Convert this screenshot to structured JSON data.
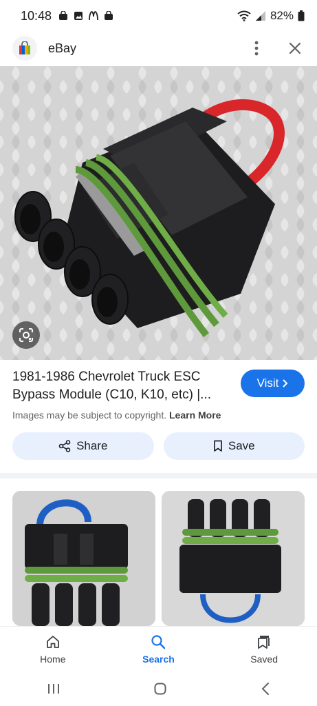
{
  "status_bar": {
    "time": "10:48",
    "battery": "82%"
  },
  "header": {
    "site_name": "eBay"
  },
  "result": {
    "title": "1981-1986 Chevrolet Truck ESC Bypass Module (C10, K10, etc) |...",
    "visit_label": "Visit",
    "copyright_text": "Images may be subject to copyright.",
    "learn_more": "Learn More",
    "share_label": "Share",
    "save_label": "Save"
  },
  "bottom_nav": {
    "items": [
      {
        "label": "Home",
        "icon": "home-icon"
      },
      {
        "label": "Search",
        "icon": "search-icon"
      },
      {
        "label": "Saved",
        "icon": "saved-icon"
      }
    ]
  },
  "colors": {
    "accent": "#1a73e8",
    "pill_bg": "#e8f0fe",
    "wire_red": "#d8262a",
    "wire_blue": "#1f5fc4",
    "seal_green": "#5e9a3b",
    "connector_black": "#1d1d1f"
  }
}
